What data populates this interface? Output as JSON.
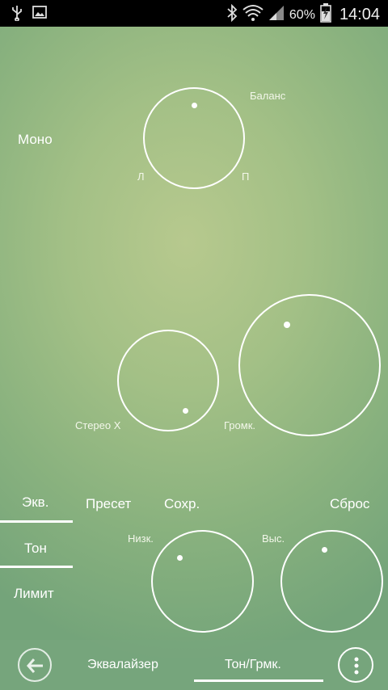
{
  "status_bar": {
    "battery_percent": "60%",
    "time": "14:04",
    "icons": [
      "usb-icon",
      "image-icon",
      "bluetooth-icon",
      "wifi-icon",
      "signal-icon",
      "battery-icon"
    ]
  },
  "balance": {
    "mono_label": "Моно",
    "title": "Баланс",
    "left": "Л",
    "right": "П"
  },
  "stereo_label": "Стерео X",
  "volume_label": "Громк.",
  "tabs": [
    "Экв.",
    "Тон",
    "Лимит"
  ],
  "actions": {
    "preset": "Пресет",
    "save": "Сохр.",
    "reset": "Сброс"
  },
  "tone": {
    "low": "Низк.",
    "high": "Выс."
  },
  "bottom_nav": {
    "equalizer": "Эквалайзер",
    "tone_volume": "Тон/Грмк."
  },
  "colors": {
    "accent": "#ffffff",
    "background": "#a3c086"
  }
}
